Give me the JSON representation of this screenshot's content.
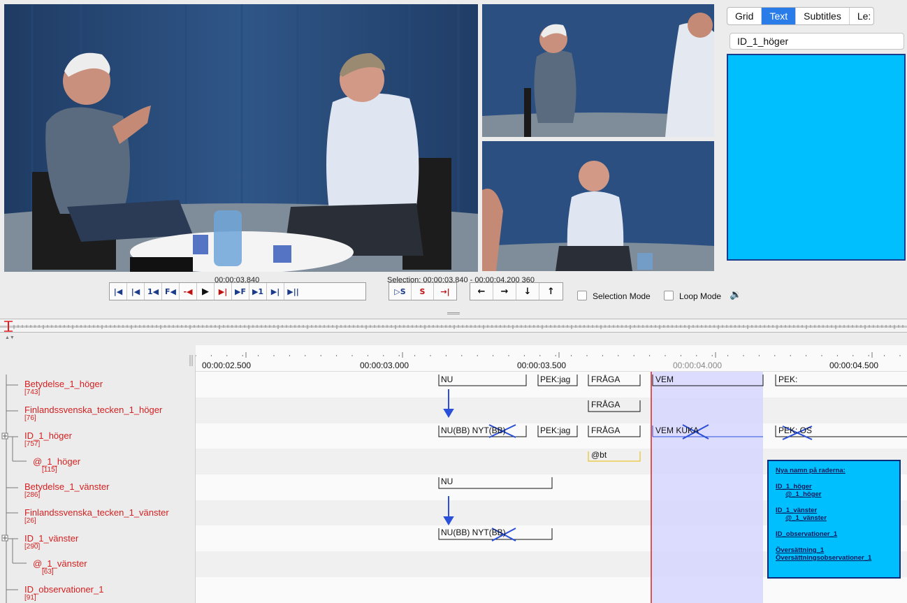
{
  "right_panel": {
    "tabs": [
      {
        "label": "Grid",
        "active": false
      },
      {
        "label": "Text",
        "active": true
      },
      {
        "label": "Subtitles",
        "active": false
      },
      {
        "label": "Le:",
        "active": false
      }
    ],
    "tier_selected": "ID_1_höger",
    "text_area_color": "#00bfff"
  },
  "media": {
    "current_time": "00:00:03.840",
    "selection": "Selection: 00:00:03.840 - 00:00:04.200  360",
    "selection_mode_label": "Selection Mode",
    "loop_mode_label": "Loop Mode",
    "play_buttons": [
      "|◀",
      "|◀",
      "1◀",
      "F◀",
      "-◀",
      "▶",
      "▶|",
      "▶F",
      "▶1",
      "▶|",
      "▶||"
    ],
    "selection_buttons": [
      "▷S",
      "S",
      "→|"
    ],
    "nav_buttons": [
      "←",
      "→",
      "↓",
      "↑"
    ]
  },
  "ruler": {
    "ticks": [
      "00:00:02.500",
      "00:00:03.000",
      "00:00:03.500",
      "00:00:04.000",
      "00:00:04.500"
    ]
  },
  "tiers": [
    {
      "name": "Betydelse_1_höger",
      "count": "[743]"
    },
    {
      "name": "Finlandssvenska_tecken_1_höger",
      "count": "[76]"
    },
    {
      "name": "ID_1_höger",
      "count": "[757]"
    },
    {
      "name": "@_1_höger",
      "count": "[115]"
    },
    {
      "name": "Betydelse_1_vänster",
      "count": "[286]"
    },
    {
      "name": "Finlandssvenska_tecken_1_vänster",
      "count": "[26]"
    },
    {
      "name": "ID_1_vänster",
      "count": "[290]"
    },
    {
      "name": "@_1_vänster",
      "count": "[63]"
    },
    {
      "name": "ID_observationer_1",
      "count": "[91]"
    }
  ],
  "annotations": {
    "betydelse_h": [
      "NU",
      "PEK:jag",
      "FRÅGA",
      "VEM",
      "PEK:"
    ],
    "finland_h": [
      "FRÅGA"
    ],
    "id_h": [
      "NU(BB) NYT(BB)",
      "PEK:jag",
      "FRÅGA",
      "VEM KUKA",
      "PEK: OS"
    ],
    "at_h": [
      "@bt"
    ],
    "betydelse_v": [
      "NU"
    ],
    "id_v": [
      "NU(BB) NYT(BB)"
    ]
  },
  "note": {
    "title": "Nya namn på raderna:",
    "lines": [
      "ID_1_höger",
      "@_1_höger",
      "ID_1_vänster",
      "@_1_vänster",
      "ID_observationer_1",
      "Översättning_1",
      "Översättningsobservationer_1"
    ]
  },
  "colors": {
    "tier_name": "#d42020",
    "selection": "#d6d6ff",
    "crosshair": "#e02020",
    "mark": "#2a4fd8",
    "accent_tab": "#2a7de9"
  }
}
